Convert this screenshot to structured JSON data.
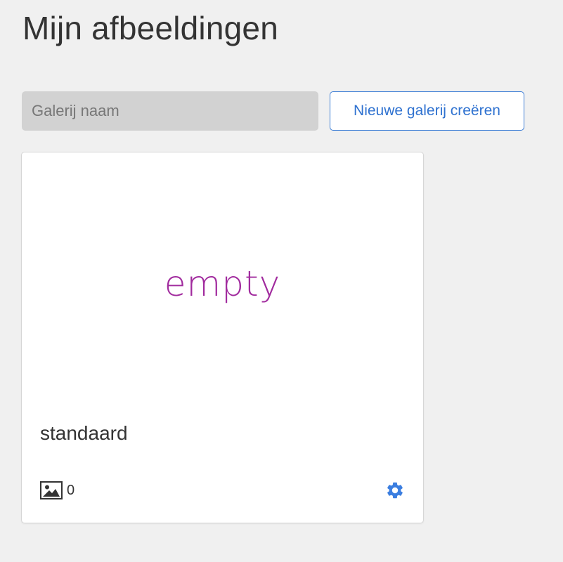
{
  "header": {
    "title": "Mijn afbeeldingen"
  },
  "toolbar": {
    "gallery_name_placeholder": "Galerij naam",
    "gallery_name_value": "",
    "create_button_label": "Nieuwe galerij creëren"
  },
  "galleries": [
    {
      "thumbnail_text": "empty",
      "name": "standaard",
      "image_count": "0",
      "count_icon": "image-icon",
      "settings_icon": "gear-icon"
    }
  ],
  "colors": {
    "background": "#f0f0f0",
    "accent_blue": "#2f72d0",
    "empty_purple": "#a12b9e",
    "input_bg": "#d2d2d2"
  }
}
